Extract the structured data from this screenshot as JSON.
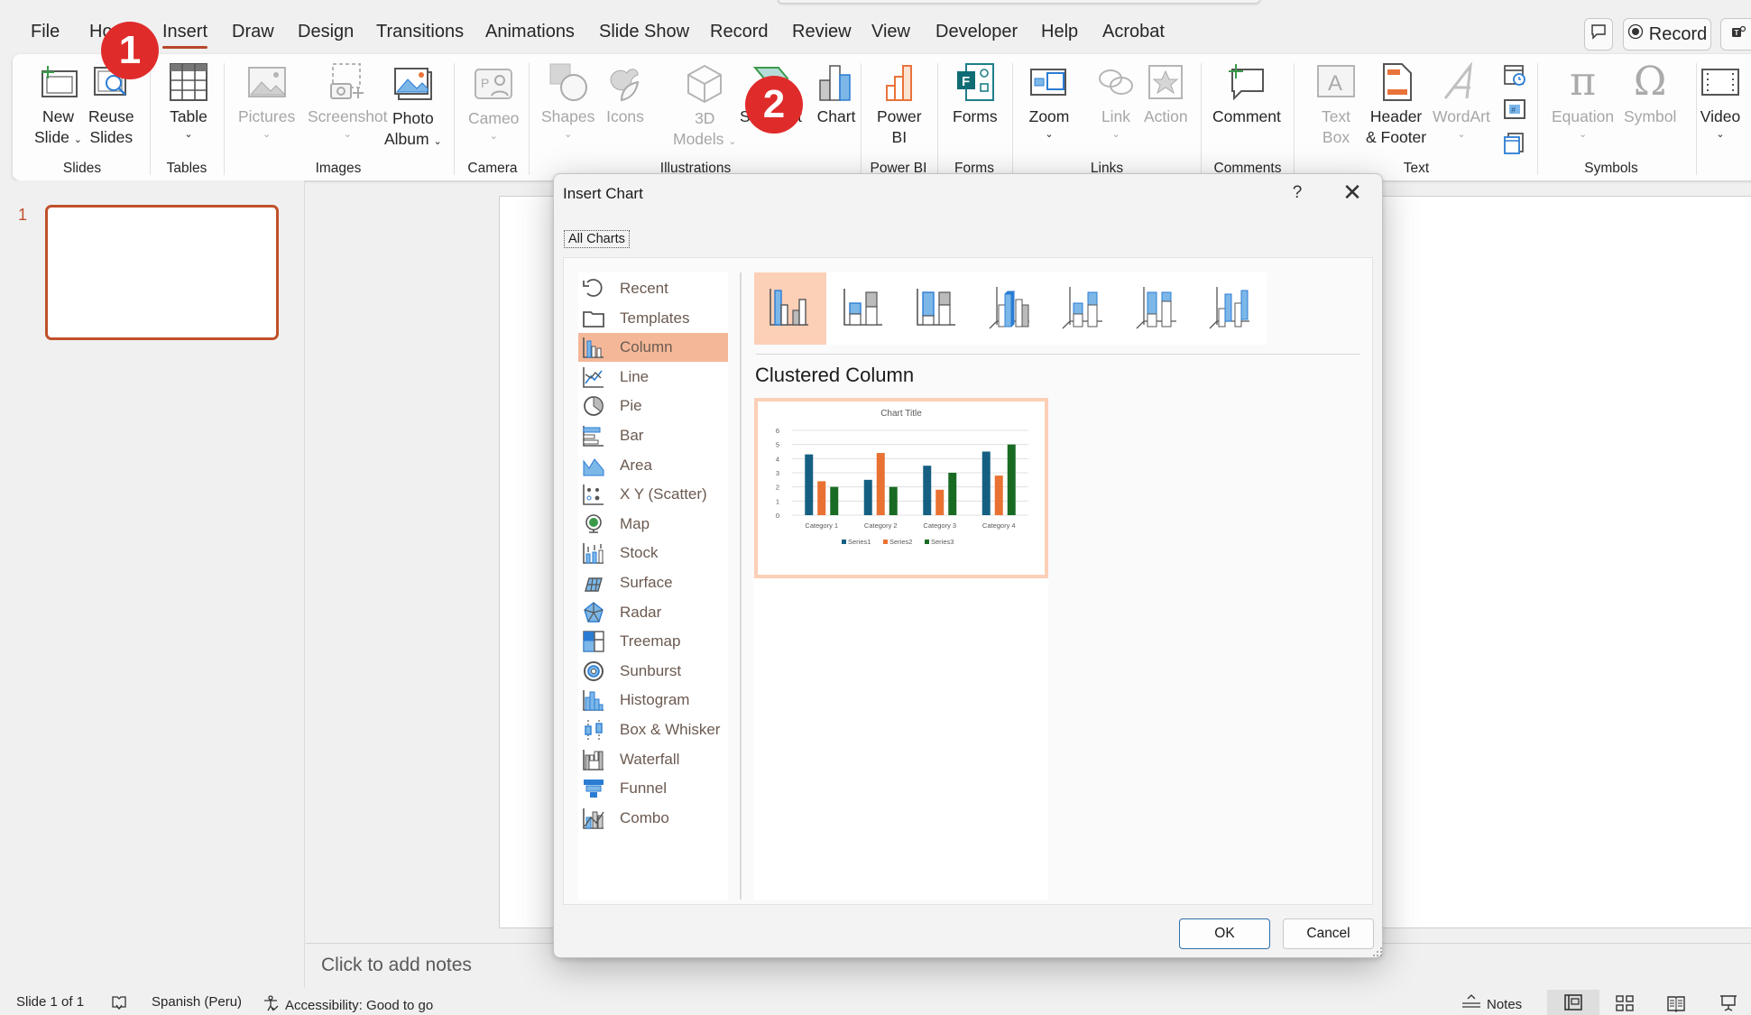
{
  "titlebar": {
    "buttons": [
      {
        "name": "comments",
        "label": ""
      },
      {
        "name": "record",
        "label": "Record"
      },
      {
        "name": "teams",
        "label": ""
      }
    ]
  },
  "tabs": [
    {
      "label": "File"
    },
    {
      "label": "Home"
    },
    {
      "label": "Insert",
      "active": true
    },
    {
      "label": "Draw"
    },
    {
      "label": "Design"
    },
    {
      "label": "Transitions"
    },
    {
      "label": "Animations"
    },
    {
      "label": "Slide Show"
    },
    {
      "label": "Record"
    },
    {
      "label": "Review"
    },
    {
      "label": "View"
    },
    {
      "label": "Developer"
    },
    {
      "label": "Help"
    },
    {
      "label": "Acrobat"
    }
  ],
  "ribbon": {
    "groups": [
      {
        "label": "Slides",
        "items": [
          {
            "line1": "New",
            "line2": "Slide",
            "chevron": true
          },
          {
            "line1": "Reuse",
            "line2": "Slides"
          }
        ]
      },
      {
        "label": "Tables",
        "items": [
          {
            "line1": "Table",
            "chevron": true
          }
        ]
      },
      {
        "label": "Images",
        "items": [
          {
            "line1": "Pictures",
            "disabled": true,
            "chevron": true
          },
          {
            "line1": "Screenshot",
            "disabled": true,
            "chevron": true
          },
          {
            "line1": "Photo",
            "line2": "Album",
            "chevron": true
          }
        ]
      },
      {
        "label": "Camera",
        "items": [
          {
            "line1": "Cameo",
            "disabled": true,
            "chevron": true
          }
        ]
      },
      {
        "label": "Illustrations",
        "items": [
          {
            "line1": "Shapes",
            "disabled": true,
            "chevron": true
          },
          {
            "line1": "Icons",
            "disabled": true
          },
          {
            "line1": "3D",
            "line2": "Models",
            "disabled": true,
            "chevron": true
          },
          {
            "line1": "SmartArt"
          },
          {
            "line1": "Chart"
          }
        ]
      },
      {
        "label": "Power BI",
        "items": [
          {
            "line1": "Power",
            "line2": "BI"
          }
        ]
      },
      {
        "label": "Forms",
        "items": [
          {
            "line1": "Forms"
          }
        ]
      },
      {
        "label": "Links",
        "items": [
          {
            "line1": "Zoom",
            "chevron": true
          },
          {
            "line1": "Link",
            "disabled": true,
            "chevron": true
          },
          {
            "line1": "Action",
            "disabled": true
          }
        ]
      },
      {
        "label": "Comments",
        "items": [
          {
            "line1": "Comment"
          }
        ]
      },
      {
        "label": "Text",
        "items": [
          {
            "line1": "Text",
            "line2": "Box",
            "disabled": true
          },
          {
            "line1": "Header",
            "line2": "& Footer"
          },
          {
            "line1": "WordArt",
            "disabled": true,
            "chevron": true
          }
        ]
      },
      {
        "label": "Symbols",
        "items": [
          {
            "line1": "Equation",
            "disabled": true,
            "chevron": true
          },
          {
            "line1": "Symbol",
            "disabled": true
          }
        ]
      },
      {
        "label": "",
        "items": [
          {
            "line1": "Video",
            "chevron": true
          }
        ]
      }
    ]
  },
  "annotations": {
    "step1": "1",
    "step2": "2"
  },
  "slides_pane": {
    "slides": [
      {
        "number": "1"
      }
    ]
  },
  "notes_placeholder": "Click to add notes",
  "status_bar": {
    "slide_info": "Slide 1 of 1",
    "language": "Spanish (Peru)",
    "accessibility": "Accessibility: Good to go",
    "notes_label": "Notes"
  },
  "dialog": {
    "title": "Insert Chart",
    "help": "?",
    "close": "✕",
    "tab": "All Charts",
    "chart_types": [
      {
        "label": "Recent",
        "icon": "recent-icon"
      },
      {
        "label": "Templates",
        "icon": "templates-icon"
      },
      {
        "label": "Column",
        "icon": "column-chart-icon",
        "selected": true
      },
      {
        "label": "Line",
        "icon": "line-chart-icon"
      },
      {
        "label": "Pie",
        "icon": "pie-chart-icon"
      },
      {
        "label": "Bar",
        "icon": "bar-chart-icon"
      },
      {
        "label": "Area",
        "icon": "area-chart-icon"
      },
      {
        "label": "X Y (Scatter)",
        "icon": "scatter-chart-icon"
      },
      {
        "label": "Map",
        "icon": "map-chart-icon"
      },
      {
        "label": "Stock",
        "icon": "stock-chart-icon"
      },
      {
        "label": "Surface",
        "icon": "surface-chart-icon"
      },
      {
        "label": "Radar",
        "icon": "radar-chart-icon"
      },
      {
        "label": "Treemap",
        "icon": "treemap-chart-icon"
      },
      {
        "label": "Sunburst",
        "icon": "sunburst-chart-icon"
      },
      {
        "label": "Histogram",
        "icon": "histogram-chart-icon"
      },
      {
        "label": "Box & Whisker",
        "icon": "box-whisker-chart-icon"
      },
      {
        "label": "Waterfall",
        "icon": "waterfall-chart-icon"
      },
      {
        "label": "Funnel",
        "icon": "funnel-chart-icon"
      },
      {
        "label": "Combo",
        "icon": "combo-chart-icon"
      }
    ],
    "subtypes": [
      {
        "name": "Clustered Column",
        "selected": true
      },
      {
        "name": "Stacked Column"
      },
      {
        "name": "100% Stacked Column"
      },
      {
        "name": "3-D Clustered Column"
      },
      {
        "name": "3-D Stacked Column"
      },
      {
        "name": "3-D 100% Stacked Column"
      },
      {
        "name": "3-D Column"
      }
    ],
    "selected_subtype_label": "Clustered Column",
    "ok": "OK",
    "cancel": "Cancel"
  },
  "colors": {
    "accent": "#b7472a",
    "selection_fill": "#f4b899",
    "series1": "#156082",
    "series2": "#e97132",
    "series3": "#196b24"
  },
  "chart_data": {
    "type": "bar",
    "title": "Chart Title",
    "categories": [
      "Category 1",
      "Category 2",
      "Category 3",
      "Category 4"
    ],
    "series": [
      {
        "name": "Series1",
        "values": [
          4.3,
          2.5,
          3.5,
          4.5
        ]
      },
      {
        "name": "Series2",
        "values": [
          2.4,
          4.4,
          1.8,
          2.8
        ]
      },
      {
        "name": "Series3",
        "values": [
          2,
          2,
          3,
          5
        ]
      }
    ],
    "ylim": [
      0,
      6
    ],
    "yticks": [
      0,
      1,
      2,
      3,
      4,
      5,
      6
    ],
    "xlabel": "",
    "ylabel": "",
    "grid": true,
    "legend": "bottom"
  }
}
